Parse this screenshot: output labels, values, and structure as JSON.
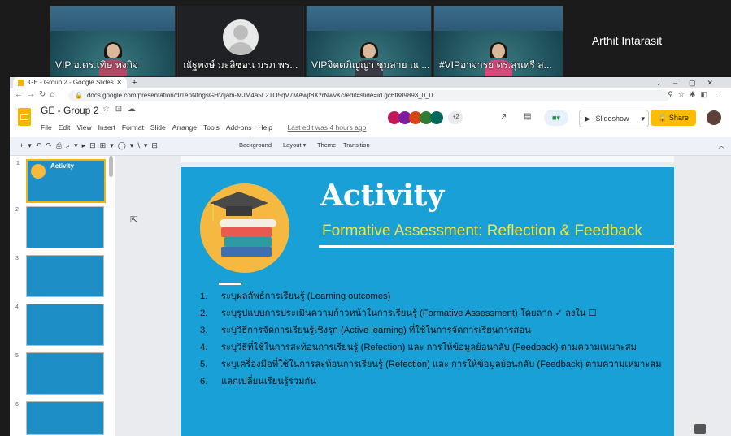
{
  "video_strip": {
    "tiles": [
      {
        "name": "VIP อ.ดร.เทิษ ทงกิจ"
      },
      {
        "name": "ณัฐพงษ์ มะลิซอน มรภ พร..."
      },
      {
        "name": "VIPจิตตภิญญา ชุมสาย ณ ..."
      },
      {
        "name": "#VIPอาจารย ดร.สุนทรี ส..."
      },
      {
        "name": "Arthit Intarasit"
      }
    ]
  },
  "browser": {
    "tab_title": "GE - Group 2 - Google Slides",
    "url": "docs.google.com/presentation/d/1epNfngsGHVljabi-MJM4a5L2TO5qV7MAwjt8XzrNwvKc/edit#slide=id.gc6f889893_0_0"
  },
  "app": {
    "doc_title": "GE - Group 2",
    "menus": [
      "File",
      "Edit",
      "View",
      "Insert",
      "Format",
      "Slide",
      "Arrange",
      "Tools",
      "Add-ons",
      "Help"
    ],
    "last_edit": "Last edit was 4 hours ago",
    "slideshow_label": "Slideshow",
    "share_label": "Share",
    "collaborators_extra": "+2"
  },
  "toolbar": {
    "background": "Background",
    "layout": "Layout ▾",
    "theme": "Theme",
    "transition": "Transition"
  },
  "slides_panel": {
    "numbers": [
      "1",
      "2",
      "3",
      "4",
      "5",
      "6"
    ],
    "first_thumb_title": "Activity"
  },
  "slide": {
    "title": "Activity",
    "subtitle": "Formative Assessment: Reflection & Feedback",
    "items": [
      {
        "num": "1.",
        "text": "ระบุผลลัพธ์การเรียนรู้ (Learning outcomes)"
      },
      {
        "num": "2.",
        "text": "ระบุรูปแบบการประเมินความก้าวหน้าในการเรียนรู้ (Formative Assessment) โดยลาก ✓ ลงใน ☐"
      },
      {
        "num": "3.",
        "text": "ระบุวิธีการจัดการเรียนรู้เชิงรุก (Active learning) ที่ใช้ในการจัดการเรียนการสอน"
      },
      {
        "num": "4.",
        "text": "ระบุวิธีที่ใช้ในการสะท้อนการเรียนรู้ (Refection) และ การให้ข้อมูลย้อนกลับ (Feedback) ตามความเหมาะสม"
      },
      {
        "num": "5.",
        "text": "ระบุเครื่องมือที่ใช้ในการสะท้อนการเรียนรู้ (Refection) และ การให้ข้อมูลย้อนกลับ (Feedback) ตามความเหมาะสม"
      },
      {
        "num": "6.",
        "text": "แลกเปลี่ยนเรียนรู้ร่วมกัน"
      }
    ]
  },
  "colors": {
    "slide_bg": "#19a0d6",
    "subtitle": "#f1e53a",
    "share_btn": "#fbbc04"
  },
  "icons": [
    "slides-logo-icon",
    "star-icon",
    "folder-icon",
    "cloud-icon",
    "trend-icon",
    "comment-icon",
    "meet-icon",
    "present-icon",
    "user-avatar"
  ]
}
